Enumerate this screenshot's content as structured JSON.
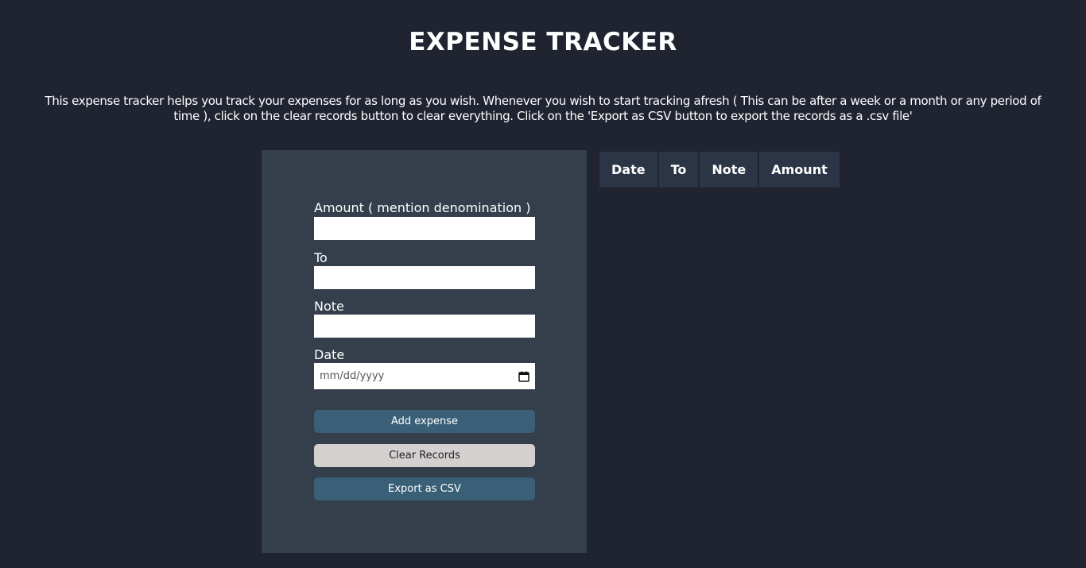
{
  "header": {
    "title": "EXPENSE TRACKER",
    "description": "This expense tracker helps you track your expenses for as long as you wish. Whenever you wish to start tracking afresh ( This can be after a week or a month or any period of time ), click on the clear records button to clear everything. Click on the 'Export as CSV button to export the records as a .csv file'"
  },
  "form": {
    "amount_label": "Amount ( mention denomination )",
    "amount_value": "",
    "to_label": "To",
    "to_value": "",
    "note_label": "Note",
    "note_value": "",
    "date_label": "Date",
    "date_placeholder": "mm/dd/yyyy",
    "calendar_icon": "calendar-icon",
    "add_button": "Add expense",
    "clear_button": "Clear Records",
    "export_button": "Export as CSV"
  },
  "table": {
    "columns": [
      "Date",
      "To",
      "Note",
      "Amount"
    ],
    "rows": []
  },
  "colors": {
    "background": "#1f2430",
    "panel": "#343f4b",
    "primary_button": "#3a6077",
    "secondary_button": "#d4d0d0",
    "table_header": "#2c3545"
  }
}
